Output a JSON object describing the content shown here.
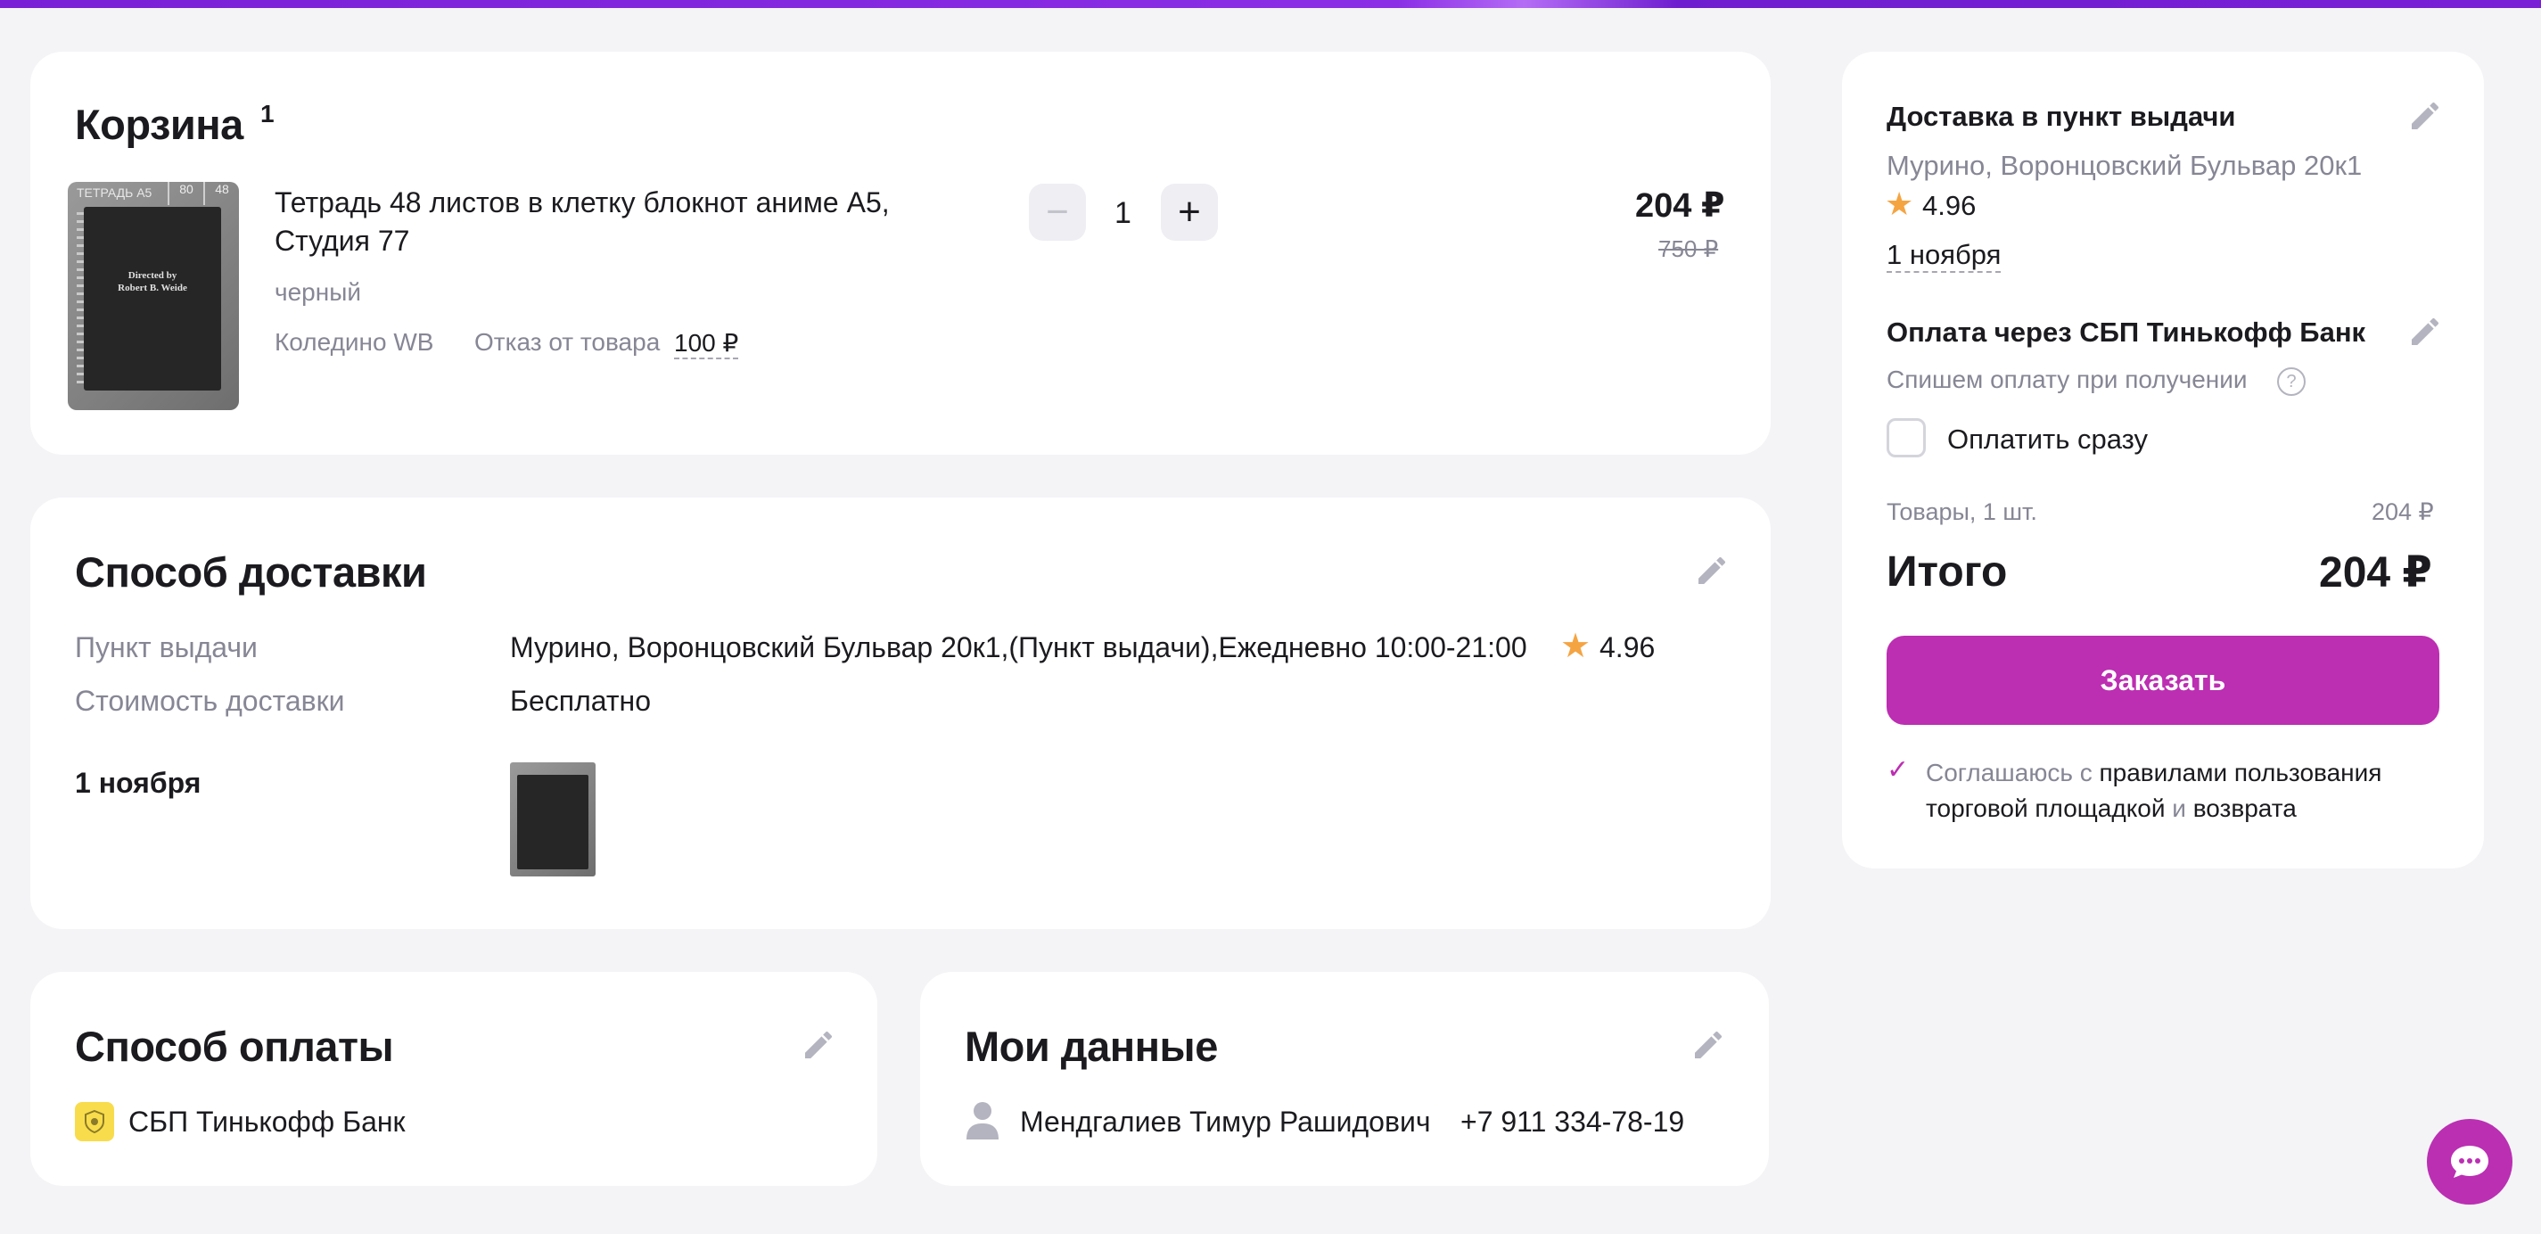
{
  "cart": {
    "title": "Корзина",
    "count": "1",
    "product": {
      "name_line1": "Тетрадь 48 листов в клетку блокнот аниме А5,",
      "name_line2": "Студия 77",
      "color": "черный",
      "warehouse": "Коледино WB",
      "refusal_label": "Отказ от товара",
      "refusal_price": "100 ₽",
      "quantity": "1",
      "price": "204 ₽",
      "old_price": "750 ₽",
      "image_tag": "ТЕТРАДЬ А5",
      "image_num1": "80",
      "image_num2": "48",
      "image_text_line1": "Directed by",
      "image_text_line2": "Robert B. Weide"
    }
  },
  "delivery_method": {
    "title": "Способ доставки",
    "pickup_label": "Пункт выдачи",
    "pickup_value": "Мурино, Воронцовский Бульвар 20к1,(Пункт выдачи),Ежедневно 10:00-21:00",
    "rating": "4.96",
    "cost_label": "Стоимость доставки",
    "cost_value": "Бесплатно",
    "date": "1 ноября"
  },
  "payment_method": {
    "title": "Способ оплаты",
    "bank": "СБП Тинькофф Банк"
  },
  "my_data": {
    "title": "Мои данные",
    "name": "Мендгалиев Тимур Рашидович",
    "phone": "+7 911 334-78-19"
  },
  "summary": {
    "delivery_title": "Доставка в пункт выдачи",
    "address": "Мурино, Воронцовский Бульвар 20к1",
    "rating": "4.96",
    "date": "1 ноября",
    "payment_title": "Оплата через СБП Тинькофф Банк",
    "payment_note": "Спишем оплату при получении",
    "pay_now_label": "Оплатить сразу",
    "goods_label": "Товары, 1 шт.",
    "goods_price": "204 ₽",
    "total_label": "Итого",
    "total_price": "204 ₽",
    "order_button": "Заказать",
    "agree_prefix": "Соглашаюсь с",
    "agree_link1_part1": "правилами пользования",
    "agree_link1_part2": "торговой площадкой",
    "agree_and": "и",
    "agree_link2": "возврата"
  },
  "colors": {
    "accent": "#bc2eb2",
    "top_bar": "#7a1fd6",
    "star": "#f5a442",
    "muted_text": "#868695"
  },
  "icons": [
    "minus-icon",
    "plus-icon",
    "pencil-icon",
    "star-icon",
    "help-icon",
    "check-icon",
    "user-icon",
    "bank-logo-icon",
    "chat-icon"
  ]
}
